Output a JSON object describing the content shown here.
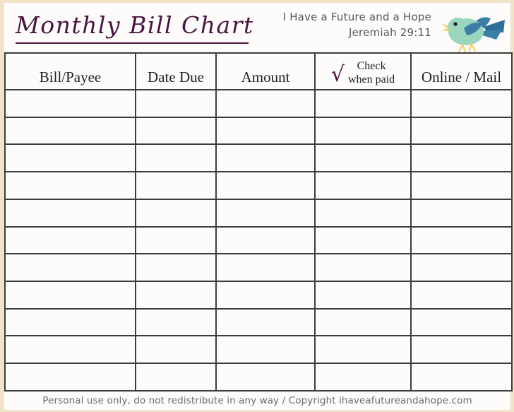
{
  "document": {
    "title": "Monthly Bill Chart",
    "verse_text": "I Have a Future and a Hope",
    "verse_reference": "Jeremiah 29:11",
    "bird_icon_name": "bird-illustration",
    "accent_purple": "#4a1440",
    "border_cream": "#f2e2c8",
    "grid_color": "#3d3d3d",
    "bird_body_color": "#9ad7bf",
    "bird_wing_color": "#3d7ea6",
    "bird_accent_color": "#f2cf63"
  },
  "table": {
    "columns": [
      {
        "id": "bill-payee",
        "label": "Bill/Payee"
      },
      {
        "id": "date-due",
        "label": "Date Due"
      },
      {
        "id": "amount",
        "label": "Amount"
      },
      {
        "id": "check-when-paid",
        "label": "Check when paid",
        "mark": "√",
        "line1": "Check",
        "line2": "when paid"
      },
      {
        "id": "online-mail",
        "label": "Online / Mail"
      }
    ],
    "row_count": 11,
    "rows": [
      [
        "",
        "",
        "",
        "",
        ""
      ],
      [
        "",
        "",
        "",
        "",
        ""
      ],
      [
        "",
        "",
        "",
        "",
        ""
      ],
      [
        "",
        "",
        "",
        "",
        ""
      ],
      [
        "",
        "",
        "",
        "",
        ""
      ],
      [
        "",
        "",
        "",
        "",
        ""
      ],
      [
        "",
        "",
        "",
        "",
        ""
      ],
      [
        "",
        "",
        "",
        "",
        ""
      ],
      [
        "",
        "",
        "",
        "",
        ""
      ],
      [
        "",
        "",
        "",
        "",
        ""
      ],
      [
        "",
        "",
        "",
        "",
        ""
      ]
    ]
  },
  "footer": {
    "text": "Personal use only, do not redistribute in any way / Copyright ihaveafutureandahope.com"
  }
}
